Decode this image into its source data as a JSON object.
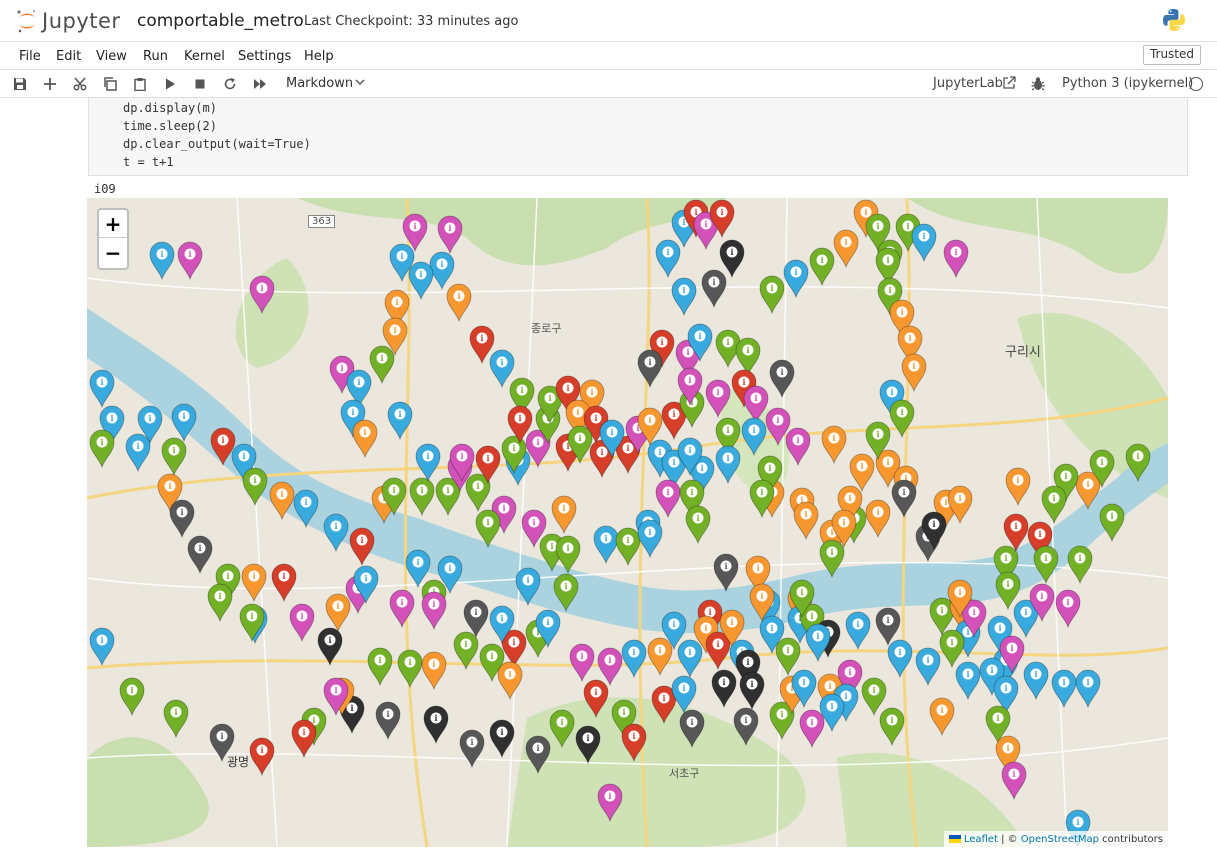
{
  "header": {
    "logo_text": "Jupyter",
    "notebook_title": "comportable_metro",
    "checkpoint": "Last Checkpoint: 33 minutes ago"
  },
  "menu": {
    "items": [
      "File",
      "Edit",
      "View",
      "Run",
      "Kernel",
      "Settings",
      "Help"
    ],
    "trusted": "Trusted"
  },
  "toolbar": {
    "cell_type": "Markdown",
    "jupyterlab_link": "JupyterLab",
    "kernel_name": "Python 3 (ipykernel)"
  },
  "code": {
    "lines": [
      "dp.display(m)",
      "time.sleep(2)",
      "dp.clear_output(wait=True)",
      "t = t+1"
    ]
  },
  "output": {
    "text": "i09"
  },
  "map": {
    "zoom_in": "+",
    "zoom_out": "−",
    "attribution_leaflet": "Leaflet",
    "attribution_sep": " | © ",
    "attribution_osm": "OpenStreetMap",
    "attribution_tail": " contributors",
    "labels": {
      "guri": "구리시",
      "route_363": "363",
      "gwangmyeong": "광명",
      "seocho": "서초구",
      "jongno": "종로구"
    },
    "marker_colors": {
      "blue": "#38aadd",
      "purple": "#d252b9",
      "orange": "#f69730",
      "red": "#d63e2a",
      "green": "#72b026",
      "gray": "#575757",
      "black": "#303030"
    },
    "marker_icon": "info-icon",
    "marker_count": 302
  }
}
